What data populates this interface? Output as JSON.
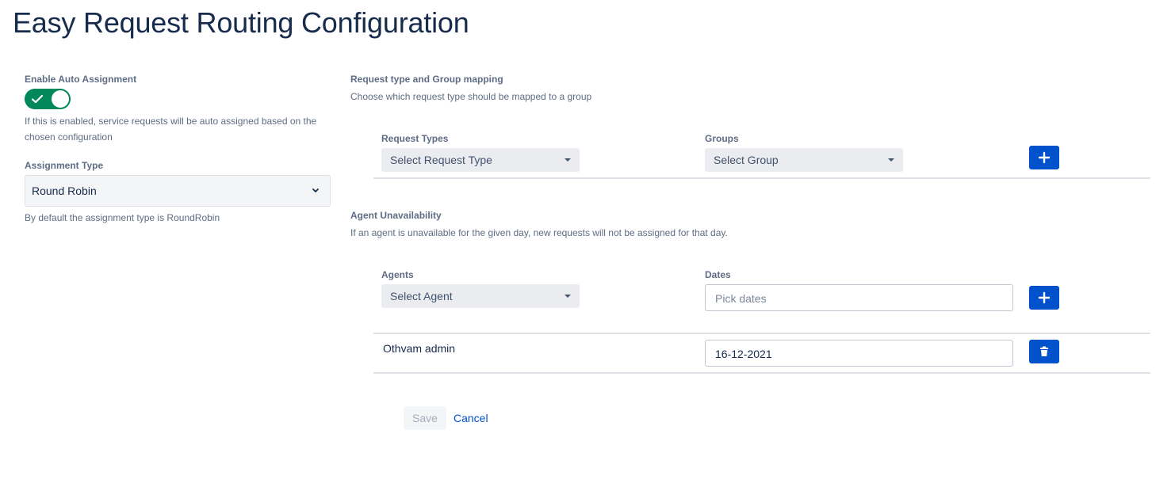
{
  "page": {
    "title": "Easy Request Routing Configuration"
  },
  "auto_assignment": {
    "label": "Enable Auto Assignment",
    "enabled": true,
    "help": "If this is enabled, service requests will be auto assigned based on the chosen configuration"
  },
  "assignment_type": {
    "label": "Assignment Type",
    "value": "Round Robin",
    "help": "By default the assignment type is RoundRobin"
  },
  "mapping": {
    "title": "Request type and Group mapping",
    "help": "Choose which request type should be mapped to a group",
    "request_types_label": "Request Types",
    "request_types_value": "Select Request Type",
    "groups_label": "Groups",
    "groups_value": "Select Group"
  },
  "unavailability": {
    "title": "Agent Unavailability",
    "help": "If an agent is unavailable for the given day, new requests will not be assigned for that day.",
    "agents_label": "Agents",
    "agents_value": "Select Agent",
    "dates_label": "Dates",
    "dates_placeholder": "Pick dates",
    "rows": [
      {
        "agent": "Othvam admin",
        "date": "16-12-2021"
      }
    ]
  },
  "actions": {
    "save_label": "Save",
    "cancel_label": "Cancel"
  },
  "colors": {
    "primary": "#0052cc",
    "toggle_on": "#00875a",
    "muted_text": "#5e6c84"
  }
}
